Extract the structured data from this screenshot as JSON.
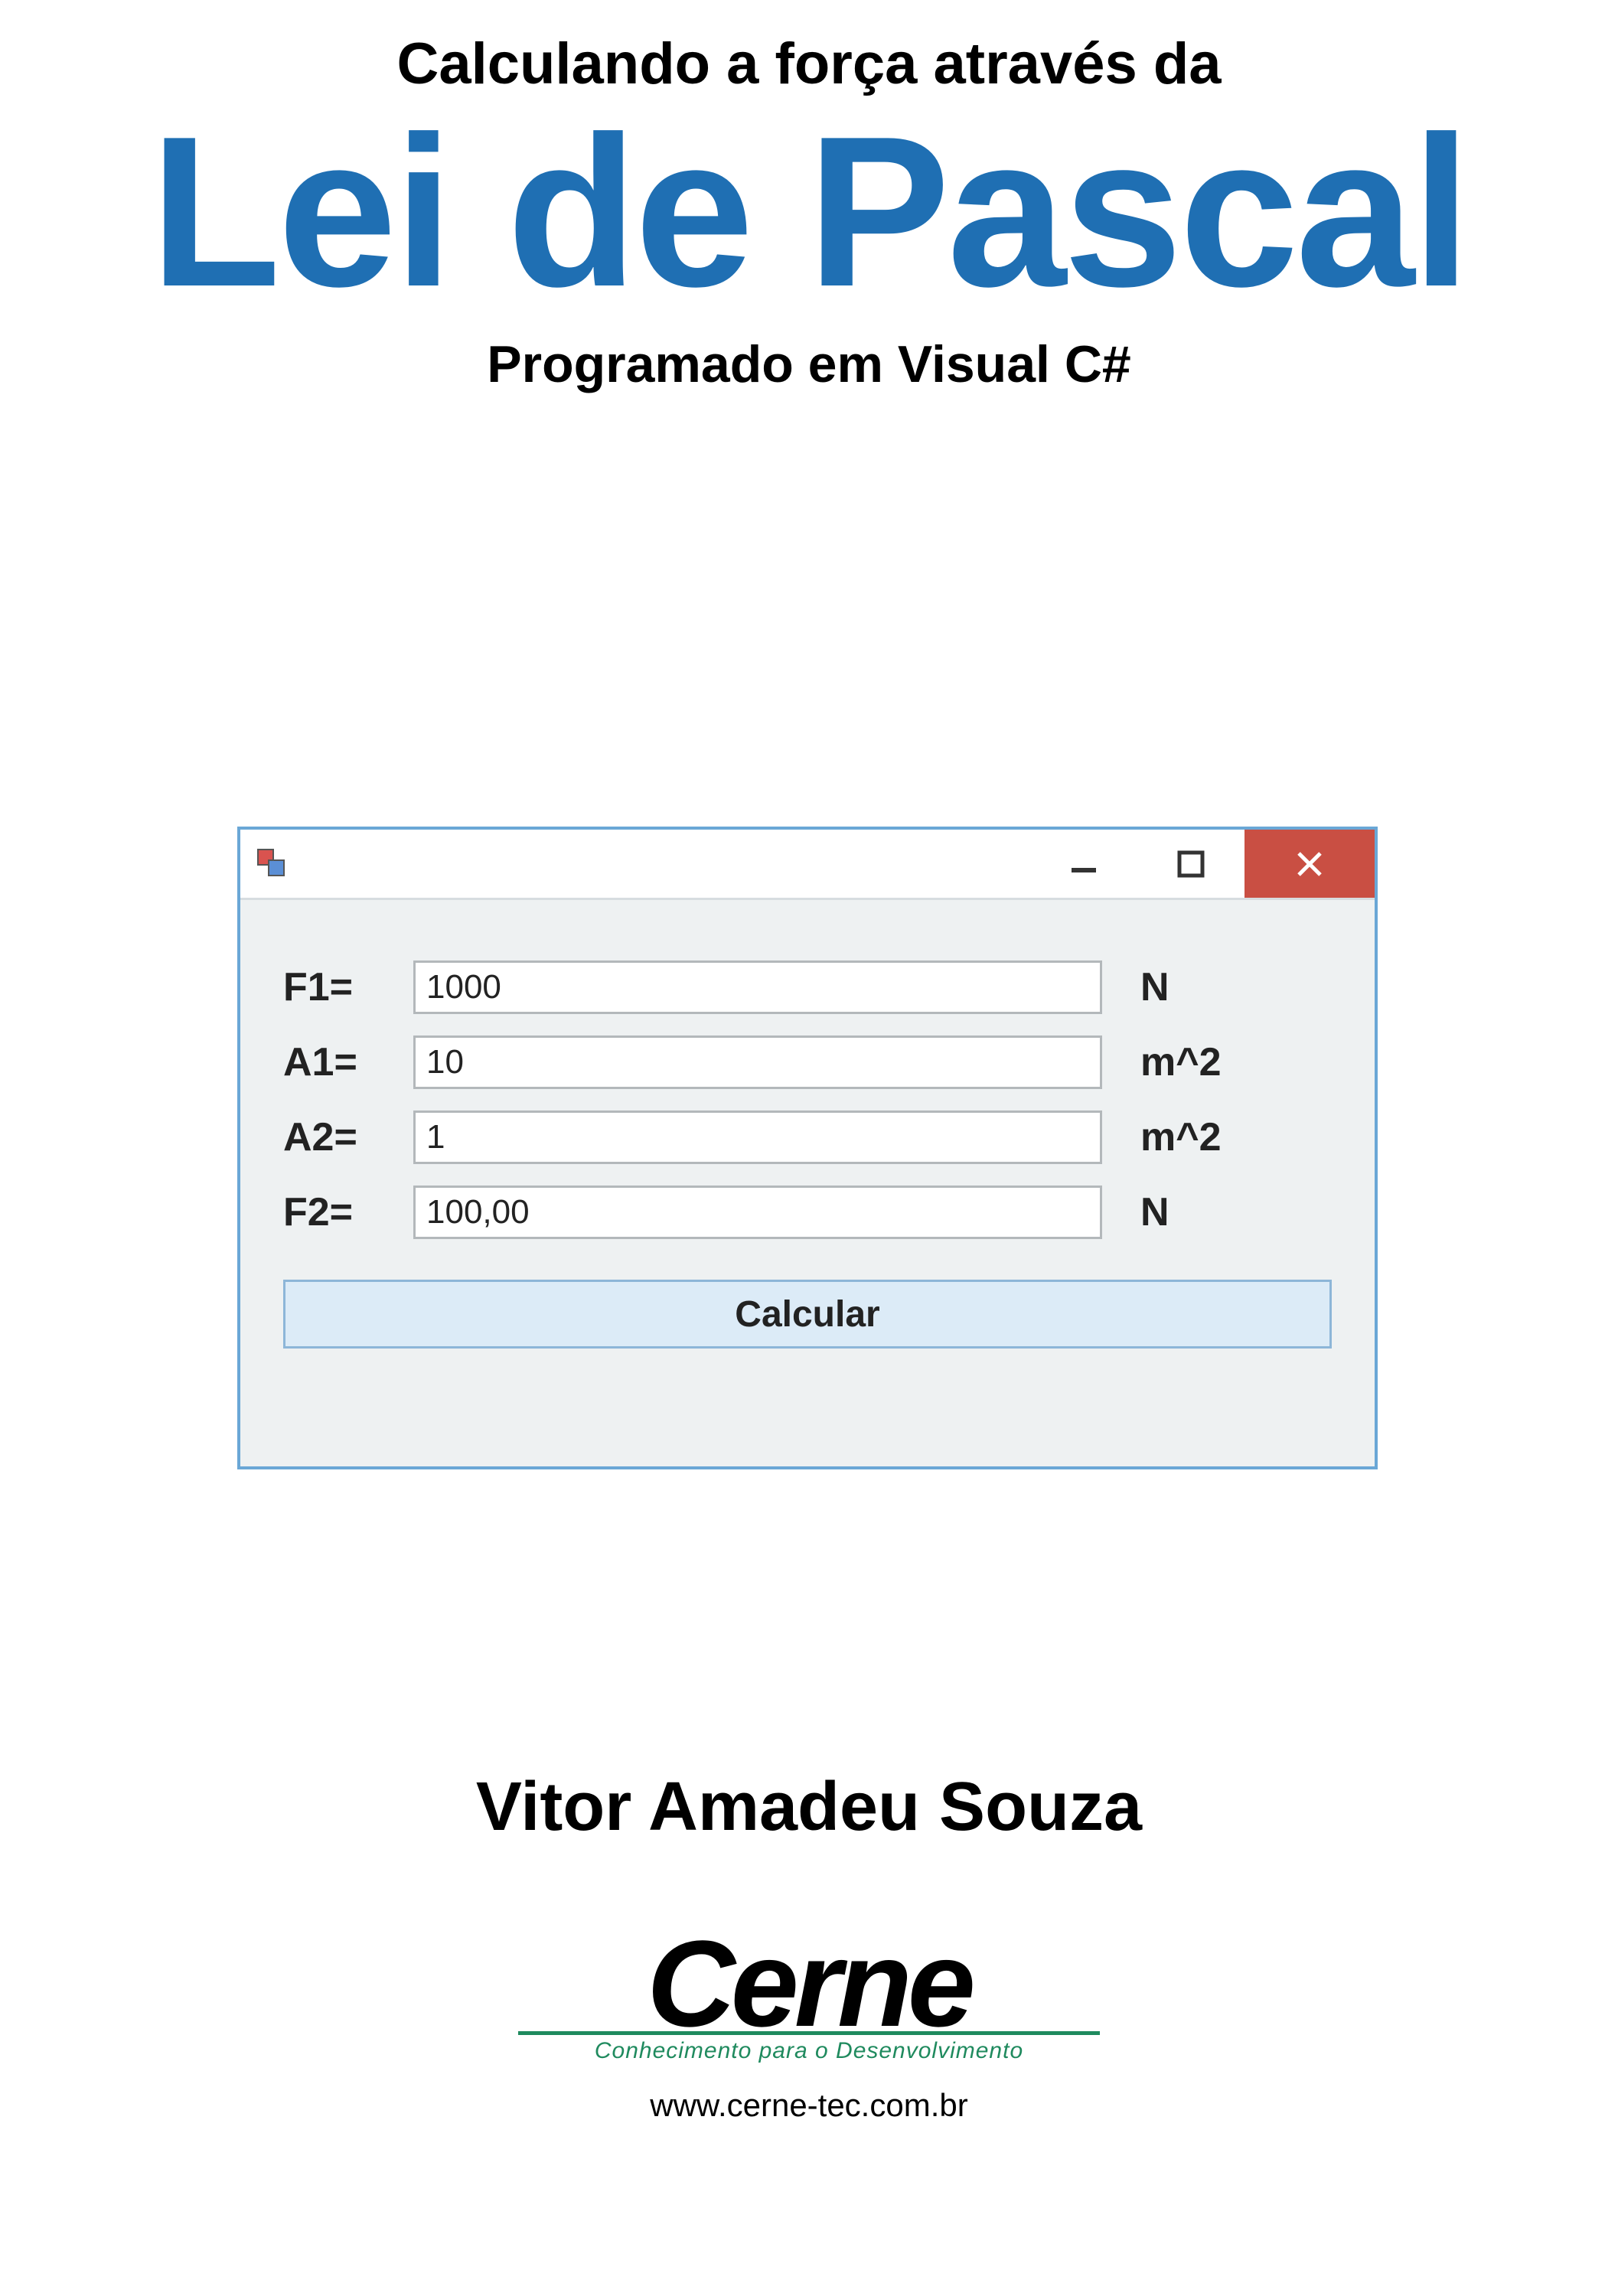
{
  "header": {
    "overline": "Calculando a força através da",
    "title": "Lei de Pascal",
    "subtitle": "Programado em Visual C#"
  },
  "window": {
    "rows": [
      {
        "label": "F1=",
        "value": "1000",
        "unit": "N"
      },
      {
        "label": "A1=",
        "value": "10",
        "unit": "m^2"
      },
      {
        "label": "A2=",
        "value": "1",
        "unit": "m^2"
      },
      {
        "label": "F2=",
        "value": "100,00",
        "unit": "N"
      }
    ],
    "button": "Calcular"
  },
  "author": "Vitor Amadeu Souza",
  "logo": {
    "word": "Cerne",
    "tagline": "Conhecimento para o Desenvolvimento",
    "url": "www.cerne-tec.com.br"
  }
}
